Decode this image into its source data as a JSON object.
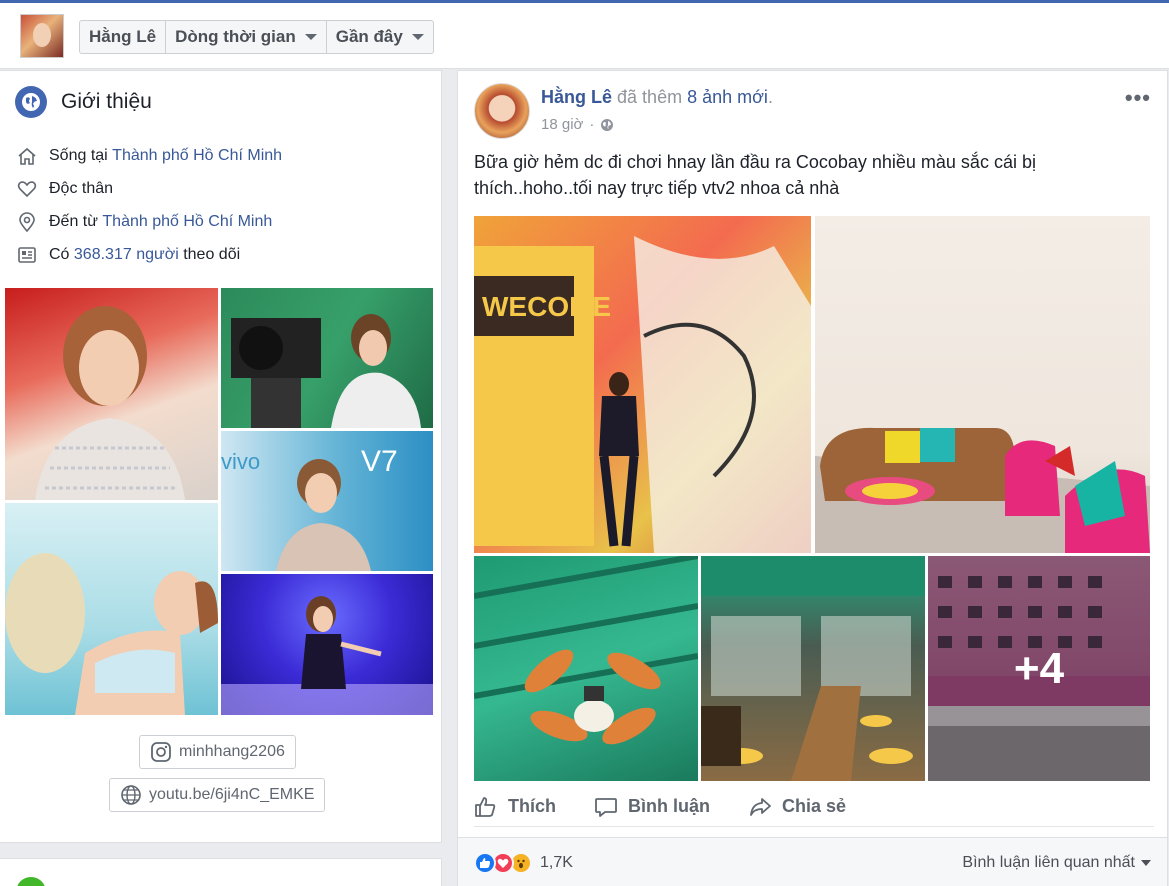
{
  "header": {
    "name": "Hằng Lê",
    "timeline_label": "Dòng thời gian",
    "recent_label": "Gần đây"
  },
  "intro": {
    "title": "Giới thiệu",
    "lives_prefix": "Sống tại",
    "lives_city": "Thành phố Hồ Chí Minh",
    "relationship": "Độc thân",
    "from_prefix": "Đến từ",
    "from_city": "Thành phố Hồ Chí Minh",
    "followers_prefix": "Có",
    "followers_link": "368.317 người",
    "followers_suffix": "theo dõi",
    "instagram": "minhhang2206",
    "website": "youtu.be/6ji4nC_EMKE"
  },
  "post": {
    "author": "Hằng Lê",
    "action_text": "đã thêm",
    "photos_link": "8 ảnh mới",
    "time": "18 giờ",
    "privacy_icon": "globe-icon",
    "text": "Bữa giờ hẻm dc đi chơi hnay lần đầu ra Cocobay nhiều màu sắc cái bị thích..hoho..tối nay trực tiếp vtv2 nhoa cả nhà",
    "extra_photos": "+4",
    "like_label": "Thích",
    "comment_label": "Bình luận",
    "share_label": "Chia sẻ",
    "reaction_count": "1,7K",
    "sort_label": "Bình luận liên quan nhất"
  },
  "colors": {
    "brand": "#4267b2",
    "link": "#385898",
    "like_blue": "#1877f2",
    "love_red": "#f33e58",
    "wow_yellow": "#f7b125"
  }
}
